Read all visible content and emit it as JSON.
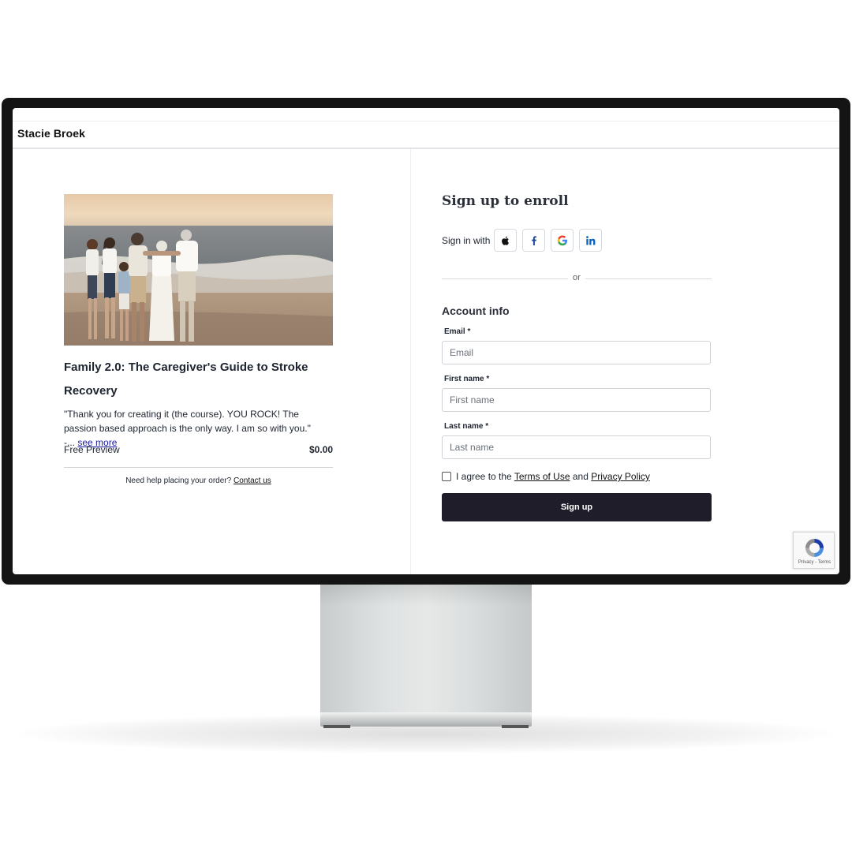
{
  "header": {
    "site_name": "Stacie Broek"
  },
  "product": {
    "image_alt": "Family standing together on a beach at sunset",
    "title": "Family 2.0: The Caregiver's Guide to Stroke Recovery",
    "quote": "\"Thank you for creating it (the course). YOU ROCK! The passion based approach is the only way. I am so with you.\" -...",
    "see_more": "see more",
    "plan_name": "Free Preview",
    "price": "$0.00",
    "help_text": "Need help placing your order?",
    "help_link": "Contact us"
  },
  "signup": {
    "title": "Sign up to enroll",
    "sign_in_with": "Sign in with",
    "social": [
      "apple-icon",
      "facebook-icon",
      "google-icon",
      "linkedin-icon"
    ],
    "or": "or",
    "section_title": "Account info",
    "fields": [
      {
        "label": "Email *",
        "placeholder": "Email"
      },
      {
        "label": "First name *",
        "placeholder": "First name"
      },
      {
        "label": "Last name *",
        "placeholder": "Last name"
      }
    ],
    "agree_prefix": "I agree to the",
    "terms": "Terms of Use",
    "and": "and",
    "privacy": "Privacy Policy",
    "button": "Sign up"
  },
  "recaptcha": {
    "text": "Privacy - Terms"
  },
  "colors": {
    "button_bg": "#1e1d29",
    "text": "#1d2430",
    "border": "#cfd3d8"
  }
}
